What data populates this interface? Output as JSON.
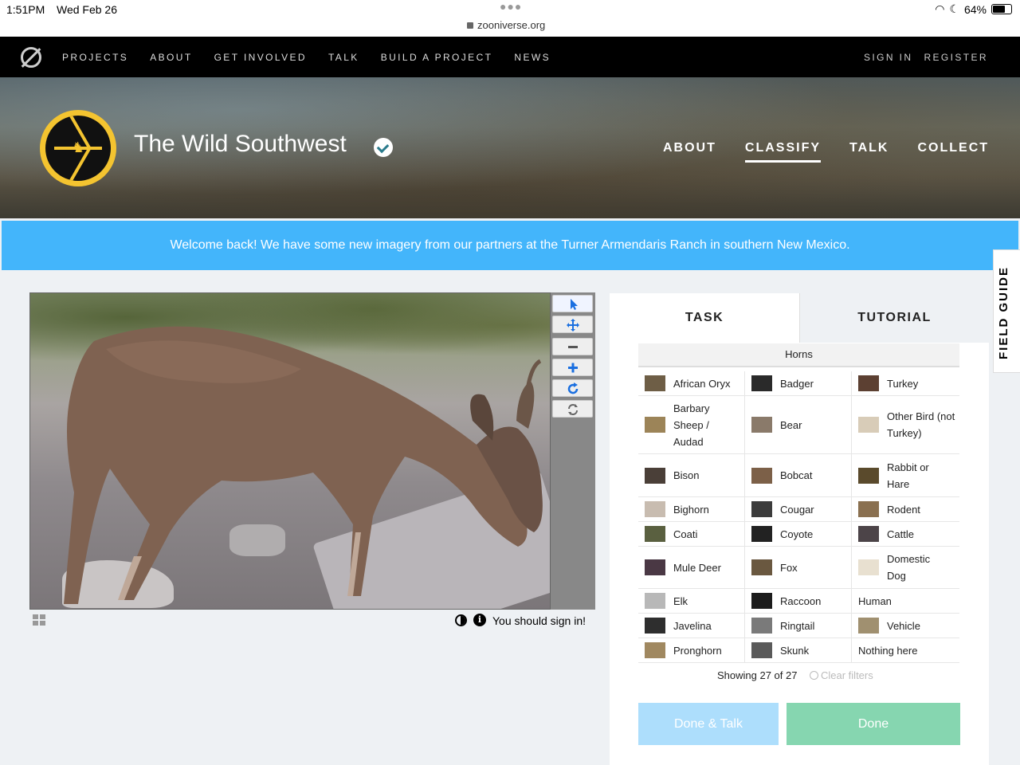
{
  "status_bar": {
    "time": "1:51PM",
    "date": "Wed Feb 26",
    "url": "zooniverse.org",
    "battery": "64%",
    "battery_level": 0.64
  },
  "top_nav": {
    "links": [
      "PROJECTS",
      "ABOUT",
      "GET INVOLVED",
      "TALK",
      "BUILD A PROJECT",
      "NEWS"
    ],
    "sign_in": "SIGN IN",
    "register": "REGISTER"
  },
  "project": {
    "title": "The Wild Southwest",
    "nav": [
      "ABOUT",
      "CLASSIFY",
      "TALK",
      "COLLECT"
    ],
    "active_nav": "CLASSIFY"
  },
  "banner": {
    "text": "Welcome back! We have some new imagery from our partners at the Turner Armendaris Ranch in southern New Mexico."
  },
  "field_guide": {
    "label": "FIELD GUIDE"
  },
  "viewer": {
    "sign_in_note": "You should sign in!"
  },
  "task_panel": {
    "tabs": {
      "task": "TASK",
      "tutorial": "TUTORIAL"
    },
    "filter_label": "Horns",
    "species": [
      [
        "African Oryx",
        "Badger",
        "Turkey"
      ],
      [
        "Barbary Sheep / Audad",
        "Bear",
        "Other Bird (not Turkey)"
      ],
      [
        "Bison",
        "Bobcat",
        "Rabbit or Hare"
      ],
      [
        "Bighorn",
        "Cougar",
        "Rodent"
      ],
      [
        "Coati",
        "Coyote",
        "Cattle"
      ],
      [
        "Mule Deer",
        "Fox",
        "Domestic Dog"
      ],
      [
        "Elk",
        "Raccoon",
        "Human"
      ],
      [
        "Javelina",
        "Ringtail",
        "Vehicle"
      ],
      [
        "Pronghorn",
        "Skunk",
        "Nothing here"
      ]
    ],
    "showing": "Showing 27 of 27",
    "clear_filters": "Clear filters",
    "done_talk": "Done & Talk",
    "done": "Done"
  },
  "colors": {
    "banner": "#43b5fb",
    "done_talk": "#addefc",
    "done": "#86d6b0",
    "accent_yellow": "#f4c430"
  }
}
